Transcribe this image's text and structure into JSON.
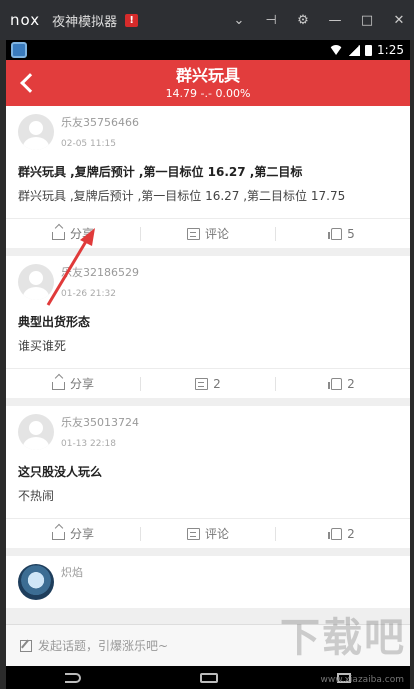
{
  "emulator": {
    "logo": "nox",
    "title": "夜神模拟器",
    "badge": "!",
    "controls": [
      "⌄",
      "⊣",
      "⚙",
      "—",
      "□",
      "✕"
    ]
  },
  "status_bar": {
    "time": "1:25"
  },
  "header": {
    "title": "群兴玩具",
    "subtitle": "14.79 -.- 0.00%"
  },
  "posts": [
    {
      "user": "乐友35756466",
      "time": "02-05 11:15",
      "title": "群兴玩具 ,复牌后预计 ,第一目标位 16.27 ,第二目标",
      "body": "群兴玩具 ,复牌后预计 ,第一目标位 16.27 ,第二目标位 17.75",
      "share": "分享",
      "comment": "评论",
      "likes": "5"
    },
    {
      "user": "乐友32186529",
      "time": "01-26 21:32",
      "title": "典型出货形态",
      "body": "谁买谁死",
      "share": "分享",
      "comment": "2",
      "likes": "2"
    },
    {
      "user": "乐友35013724",
      "time": "01-13 22:18",
      "title": "这只股没人玩么",
      "body": "不热闹",
      "share": "分享",
      "comment": "评论",
      "likes": "2"
    },
    {
      "user": "炽焰"
    }
  ],
  "composer": {
    "placeholder": "发起话题，引爆涨乐吧~"
  },
  "watermark": {
    "text": "下载吧",
    "url": "www.xiazaiba.com"
  },
  "colors": {
    "header": "#e23d3d",
    "annotation_arrow": "#e03a3a"
  },
  "icons": [
    "back-icon",
    "share-icon",
    "comment-icon",
    "like-icon",
    "edit-icon"
  ]
}
